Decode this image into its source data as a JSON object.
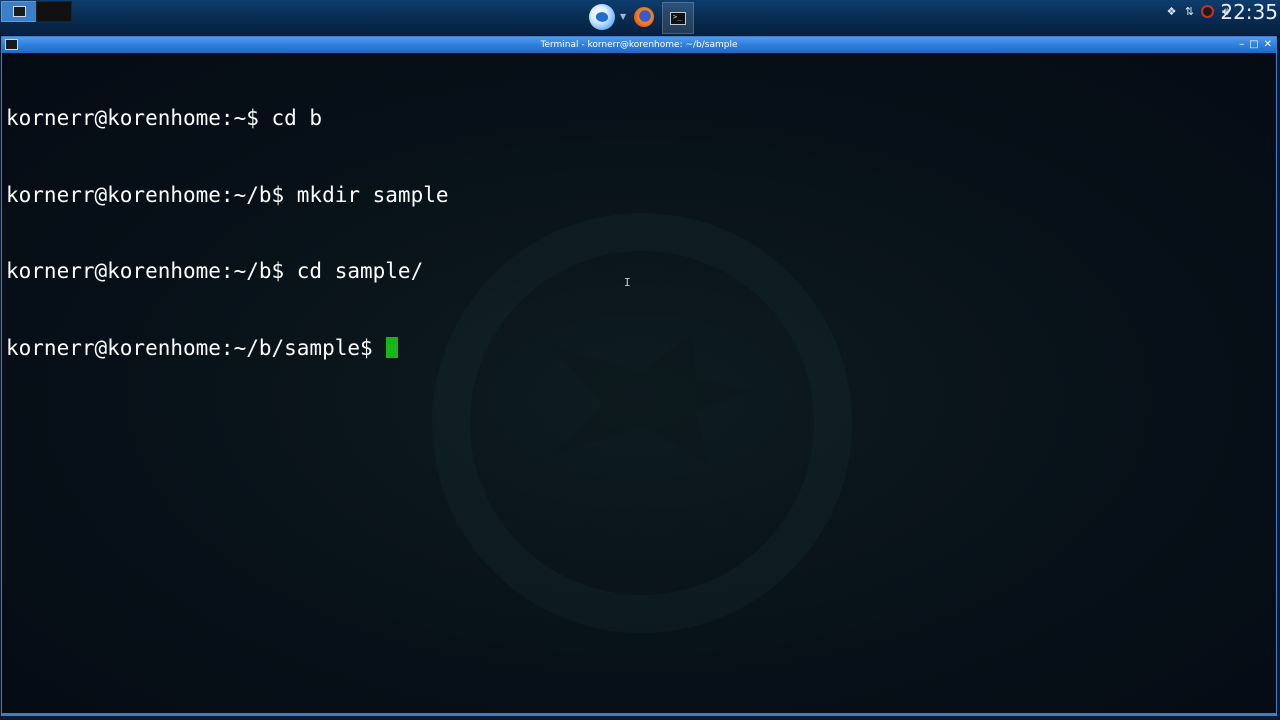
{
  "panel": {
    "pager": [
      "desktop-1",
      "desktop-2"
    ],
    "launchers": [
      "app-menu",
      "firefox",
      "terminal"
    ],
    "tray_icons": [
      "dropbox-icon",
      "network-icon",
      "updates-icon",
      "volume-icon"
    ],
    "clock": "22:35"
  },
  "window": {
    "title": "Terminal - kornerr@korenhome: ~/b/sample",
    "controls": {
      "minimize": "–",
      "maximize": "□",
      "close": "✕"
    }
  },
  "terminal": {
    "lines": [
      "kornerr@korenhome:~$ cd b",
      "kornerr@korenhome:~/b$ mkdir sample",
      "kornerr@korenhome:~/b$ cd sample/",
      "kornerr@korenhome:~/b/sample$ "
    ],
    "cursor_color": "#18b418"
  },
  "colors": {
    "panel": "#0a2e55",
    "titlebar": "#2f7fdb",
    "terminal_bg": "#050b14",
    "text": "#ffffff"
  }
}
